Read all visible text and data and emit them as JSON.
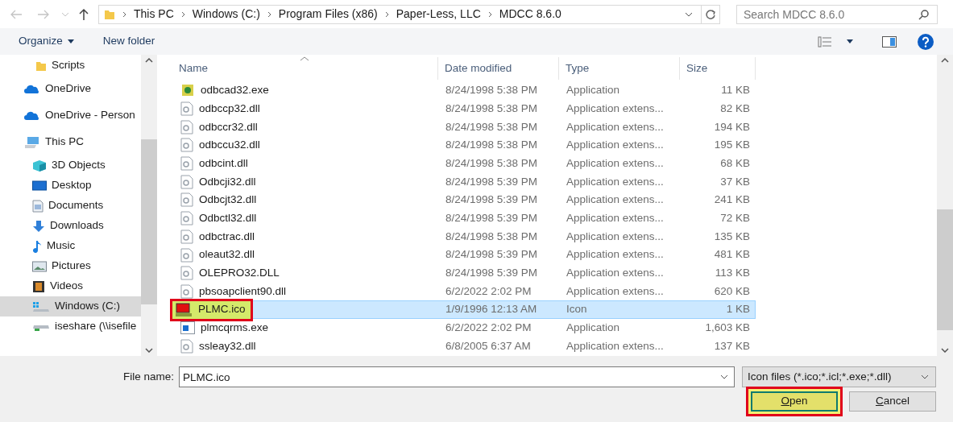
{
  "address_bar": {
    "path": [
      "This PC",
      "Windows (C:)",
      "Program Files (x86)",
      "Paper-Less, LLC",
      "MDCC 8.6.0"
    ],
    "search": {
      "placeholder": "Search MDCC 8.6.0"
    }
  },
  "toolbar": {
    "organize": "Organize",
    "new_folder": "New folder"
  },
  "sidebar": {
    "items": [
      {
        "label": "Scripts",
        "kind": "folder",
        "selected": false
      },
      {
        "label": "OneDrive",
        "kind": "cloud",
        "selected": false
      },
      {
        "label": "OneDrive - Person",
        "kind": "cloud",
        "selected": false
      },
      {
        "label": "This PC",
        "kind": "pc",
        "selected": false,
        "children": [
          {
            "label": "3D Objects",
            "kind": "cube",
            "selected": false
          },
          {
            "label": "Desktop",
            "kind": "desktop",
            "selected": false
          },
          {
            "label": "Documents",
            "kind": "document",
            "selected": false
          },
          {
            "label": "Downloads",
            "kind": "download",
            "selected": false
          },
          {
            "label": "Music",
            "kind": "music",
            "selected": false
          },
          {
            "label": "Pictures",
            "kind": "pictures",
            "selected": false
          },
          {
            "label": "Videos",
            "kind": "video",
            "selected": false
          },
          {
            "label": "Windows (C:)",
            "kind": "drive",
            "selected": true
          },
          {
            "label": "iseshare (\\\\isefile",
            "kind": "netdrive",
            "selected": false
          }
        ]
      }
    ]
  },
  "table": {
    "columns": [
      "Name",
      "Date modified",
      "Type",
      "Size"
    ],
    "rows": [
      {
        "name": "odbcad32.exe",
        "date": "8/24/1998 5:38 PM",
        "type": "Application",
        "size": "11 KB",
        "kind": "app",
        "selected": false,
        "highlighted": false
      },
      {
        "name": "odbccp32.dll",
        "date": "8/24/1998 5:38 PM",
        "type": "Application extens...",
        "size": "82 KB",
        "kind": "dll",
        "selected": false,
        "highlighted": false
      },
      {
        "name": "odbccr32.dll",
        "date": "8/24/1998 5:38 PM",
        "type": "Application extens...",
        "size": "194 KB",
        "kind": "dll",
        "selected": false,
        "highlighted": false
      },
      {
        "name": "odbccu32.dll",
        "date": "8/24/1998 5:38 PM",
        "type": "Application extens...",
        "size": "195 KB",
        "kind": "dll",
        "selected": false,
        "highlighted": false
      },
      {
        "name": "odbcint.dll",
        "date": "8/24/1998 5:38 PM",
        "type": "Application extens...",
        "size": "68 KB",
        "kind": "dll",
        "selected": false,
        "highlighted": false
      },
      {
        "name": "Odbcji32.dll",
        "date": "8/24/1998 5:39 PM",
        "type": "Application extens...",
        "size": "37 KB",
        "kind": "dll",
        "selected": false,
        "highlighted": false
      },
      {
        "name": "Odbcjt32.dll",
        "date": "8/24/1998 5:39 PM",
        "type": "Application extens...",
        "size": "241 KB",
        "kind": "dll",
        "selected": false,
        "highlighted": false
      },
      {
        "name": "Odbctl32.dll",
        "date": "8/24/1998 5:39 PM",
        "type": "Application extens...",
        "size": "72 KB",
        "kind": "dll",
        "selected": false,
        "highlighted": false
      },
      {
        "name": "odbctrac.dll",
        "date": "8/24/1998 5:38 PM",
        "type": "Application extens...",
        "size": "135 KB",
        "kind": "dll",
        "selected": false,
        "highlighted": false
      },
      {
        "name": "oleaut32.dll",
        "date": "8/24/1998 5:39 PM",
        "type": "Application extens...",
        "size": "481 KB",
        "kind": "dll",
        "selected": false,
        "highlighted": false
      },
      {
        "name": "OLEPRO32.DLL",
        "date": "8/24/1998 5:39 PM",
        "type": "Application extens...",
        "size": "113 KB",
        "kind": "dll",
        "selected": false,
        "highlighted": false
      },
      {
        "name": "pbsoapclient90.dll",
        "date": "6/2/2022 2:02 PM",
        "type": "Application extens...",
        "size": "620 KB",
        "kind": "dll",
        "selected": false,
        "highlighted": false
      },
      {
        "name": "PLMC.ico",
        "date": "1/9/1996 12:13 AM",
        "type": "Icon",
        "size": "1 KB",
        "kind": "ico",
        "selected": true,
        "highlighted": true
      },
      {
        "name": "plmcqrms.exe",
        "date": "6/2/2022 2:02 PM",
        "type": "Application",
        "size": "1,603 KB",
        "kind": "exe",
        "selected": false,
        "highlighted": false
      },
      {
        "name": "ssleay32.dll",
        "date": "6/8/2005 6:37 AM",
        "type": "Application extens...",
        "size": "137 KB",
        "kind": "dll",
        "selected": false,
        "highlighted": false
      }
    ]
  },
  "footer": {
    "file_name_label": "File name:",
    "file_name": "PLMC.ico",
    "filter": "Icon files (*.ico;*.icl;*.exe;*.dll)",
    "buttons": [
      {
        "label": "Open",
        "kind": "primary",
        "highlighted": true
      },
      {
        "label": "Cancel",
        "kind": "secondary",
        "highlighted": false
      }
    ]
  }
}
